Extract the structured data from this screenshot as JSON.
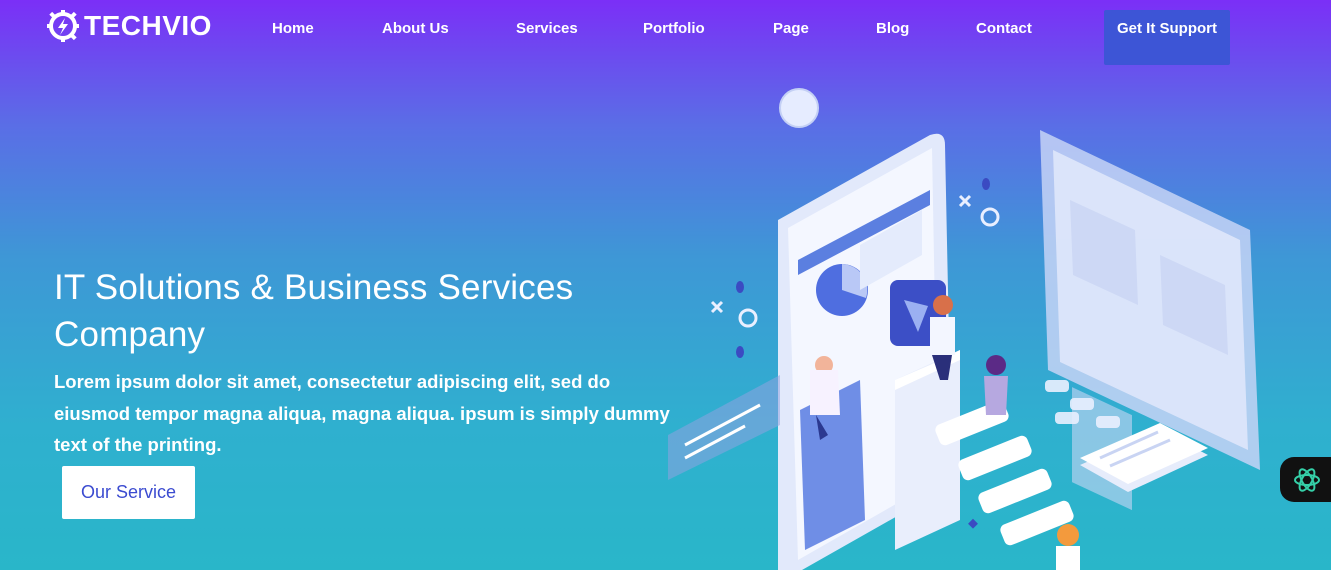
{
  "brand": {
    "name": "TECHVIO",
    "icon": "gear-bolt-icon"
  },
  "nav": {
    "items": [
      {
        "label": "Home"
      },
      {
        "label": "About Us"
      },
      {
        "label": "Services"
      },
      {
        "label": "Portfolio"
      },
      {
        "label": "Page"
      },
      {
        "label": "Blog"
      },
      {
        "label": "Contact"
      }
    ],
    "cta_label": "Get It Support"
  },
  "hero": {
    "title": "IT Solutions & Business Services Company",
    "description": "Lorem ipsum dolor sit amet, consectetur adipiscing elit, sed do eiusmod tempor magna aliqua, magna aliqua. ipsum is simply dummy text of the printing.",
    "button_label": "Our Service"
  },
  "colors": {
    "gradient_top": "#7b2ff7",
    "gradient_bottom": "#29b6c9",
    "button_blue": "#3d55d6",
    "cta_text": "#3b4bd0"
  },
  "assistant": {
    "icon": "ai-assistant-icon"
  }
}
